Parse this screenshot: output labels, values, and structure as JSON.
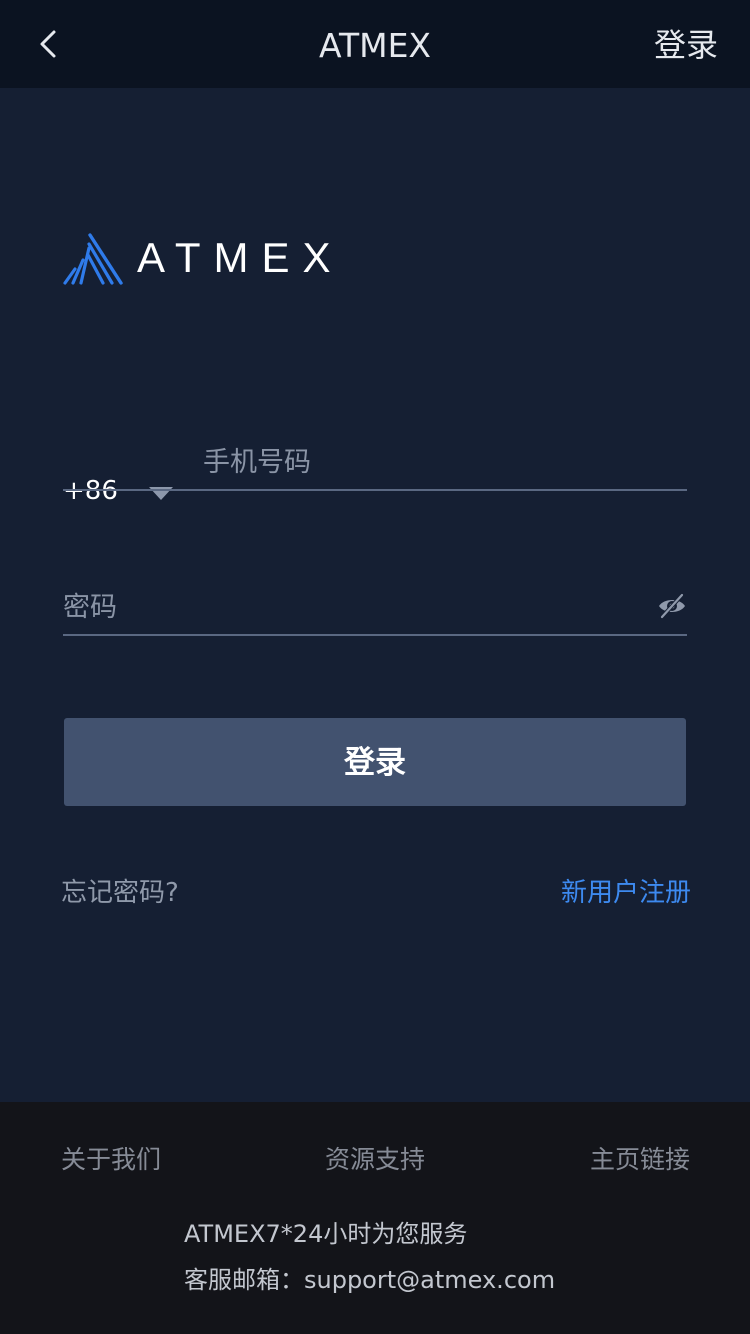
{
  "navbar": {
    "back_icon": "chevron-left-icon",
    "title": "ATMEX",
    "login_label": "登录"
  },
  "logo": {
    "mark_icon": "atmex-logo-mark-icon",
    "text": "ATMEX",
    "brand_color": "#2f7bea"
  },
  "form": {
    "country_code": "+86",
    "country_caret_icon": "caret-down-icon",
    "phone_placeholder": "手机号码",
    "phone_value": "",
    "password_placeholder": "密码",
    "password_value": "",
    "eye_icon": "eye-off-icon",
    "submit_label": "登录",
    "forgot_label": "忘记密码?",
    "register_label": "新用户注册"
  },
  "footer": {
    "links": [
      "关于我们",
      "资源支持",
      "主页链接"
    ],
    "service_text": "ATMEX7*24小时为您服务",
    "email_text": "客服邮箱：support@atmex.com"
  },
  "colors": {
    "page_bg": "#151f33",
    "navbar_bg": "#0b1321",
    "button_bg": "#42526f",
    "link_blue": "#3d8af0",
    "footer_bg": "#131419"
  }
}
